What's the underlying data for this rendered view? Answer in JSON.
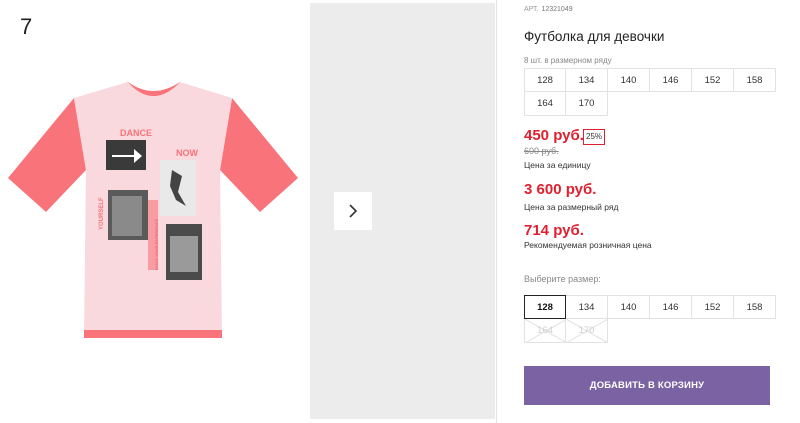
{
  "page_number": "7",
  "gallery": {
    "next_icon": "chevron-right-icon",
    "print_text": {
      "dance": "DANCE",
      "now": "NOW",
      "side_text": "YOURSELF",
      "vertical_text": "BUILD YOUR EXPERIENCE"
    }
  },
  "product": {
    "article_label": "АРТ.",
    "article_number": "12321049",
    "title": "Футболка для девочки",
    "pack_label": "8 шт. в размерном ряду",
    "pack_sizes": [
      "128",
      "134",
      "140",
      "146",
      "152",
      "158",
      "164",
      "170"
    ],
    "price": "450 руб.",
    "discount": "25%",
    "old_price": "600 руб.",
    "unit_price_label": "Цена за единицу",
    "pack_price": "3 600 руб.",
    "pack_price_label": "Цена за размерный ряд",
    "rrp": "714 руб.",
    "rrp_label": "Рекомендуемая розничная цена",
    "choose_size_label": "Выберите размер:",
    "selectable_sizes": [
      {
        "label": "128",
        "state": "selected"
      },
      {
        "label": "134",
        "state": "available"
      },
      {
        "label": "140",
        "state": "available"
      },
      {
        "label": "146",
        "state": "available"
      },
      {
        "label": "152",
        "state": "available"
      },
      {
        "label": "158",
        "state": "available"
      },
      {
        "label": "164",
        "state": "unavailable"
      },
      {
        "label": "170",
        "state": "unavailable"
      }
    ],
    "add_to_cart": "ДОБАВИТЬ В КОРЗИНУ"
  },
  "colors": {
    "accent_purple": "#7b62a3",
    "price_red": "#e0202f",
    "shirt_body": "#f9d9dd",
    "shirt_sleeves": "#f9737a"
  }
}
